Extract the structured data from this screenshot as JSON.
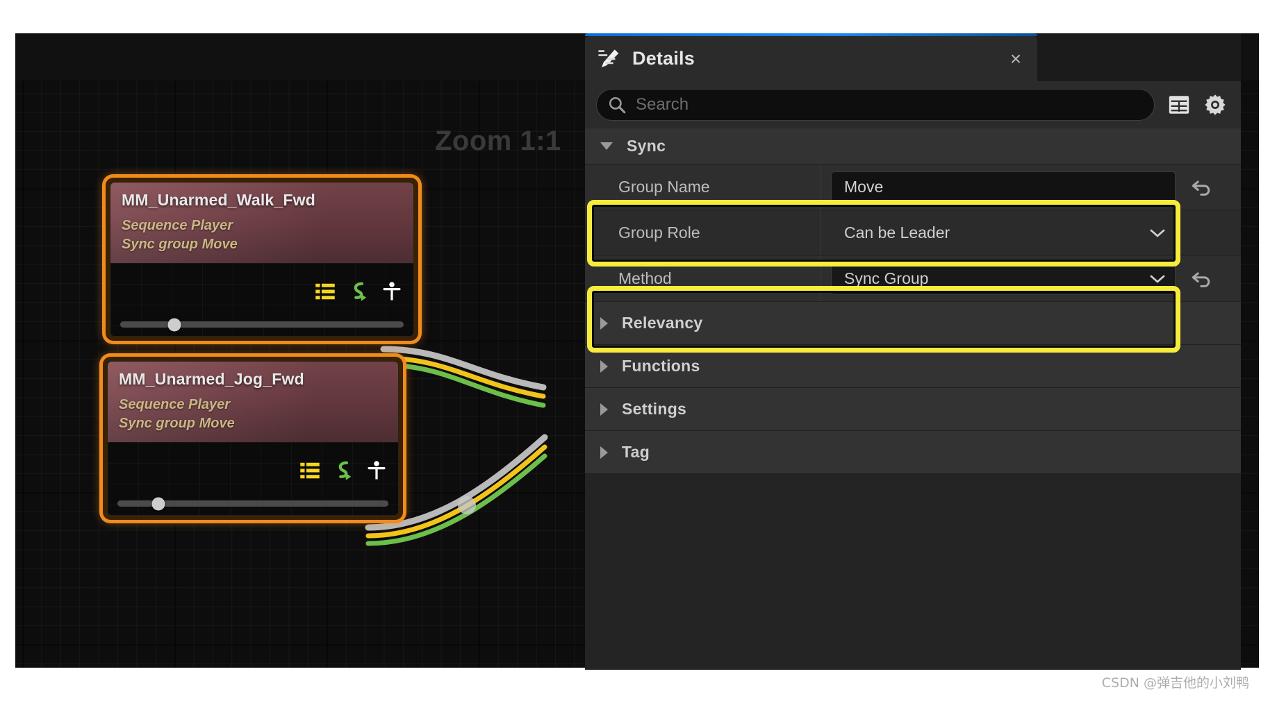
{
  "graph": {
    "zoom_label": "Zoom 1:1",
    "nodes": [
      {
        "title": "MM_Unarmed_Walk_Fwd",
        "subtitle_line1": "Sequence Player",
        "subtitle_line2": "Sync group Move",
        "icons": [
          "list-icon",
          "loop-arrow-icon",
          "person-icon"
        ],
        "slider_position_pct": 19
      },
      {
        "title": "MM_Unarmed_Jog_Fwd",
        "subtitle_line1": "Sequence Player",
        "subtitle_line2": "Sync group Move",
        "icons": [
          "list-icon",
          "loop-arrow-icon",
          "person-icon"
        ],
        "slider_position_pct": 15
      }
    ]
  },
  "details_panel": {
    "tab": {
      "label": "Details",
      "icon": "details-pencil-icon",
      "close_label": "×"
    },
    "search": {
      "placeholder": "Search",
      "icon": "search-icon",
      "buttons": [
        {
          "name": "table-view-icon"
        },
        {
          "name": "settings-gear-icon"
        }
      ]
    },
    "categories": [
      {
        "label": "Sync",
        "expanded": true
      },
      {
        "label": "Relevancy",
        "expanded": false
      },
      {
        "label": "Functions",
        "expanded": false
      },
      {
        "label": "Settings",
        "expanded": false
      },
      {
        "label": "Tag",
        "expanded": false
      }
    ],
    "sync_properties": [
      {
        "name": "Group Name",
        "value": "Move",
        "control": "text",
        "has_reset": true,
        "highlighted": true
      },
      {
        "name": "Group Role",
        "value": "Can be Leader",
        "control": "combo",
        "has_reset": false,
        "highlighted": false
      },
      {
        "name": "Method",
        "value": "Sync Group",
        "control": "combo",
        "has_reset": true,
        "highlighted": true
      }
    ]
  },
  "colors": {
    "highlight_yellow": "#f7ec3d",
    "node_selection_orange": "#f08b1d",
    "tab_accent_blue": "#1b86ef",
    "node_header_red": "#7c464d",
    "node_subtitle_gold": "#cbb784",
    "wire_white": "#d8d8d8",
    "wire_yellow": "#f2c41a",
    "wire_green": "#6cbf4a"
  },
  "watermark": "CSDN @弹吉他的小刘鸭"
}
